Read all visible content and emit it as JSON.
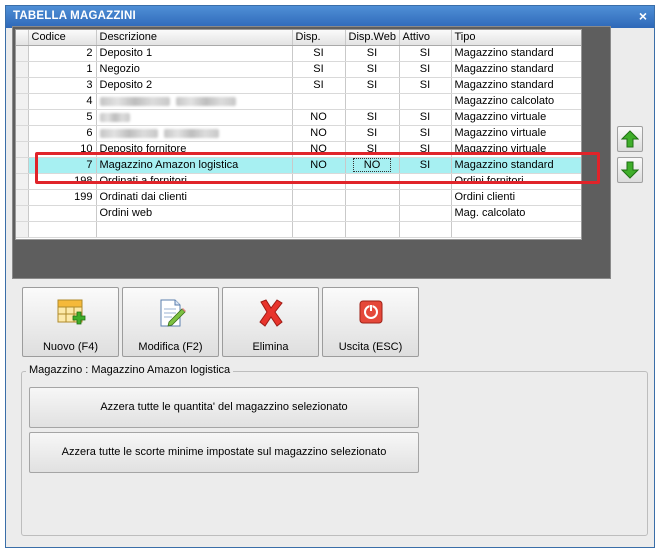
{
  "window": {
    "title": "TABELLA MAGAZZINI",
    "close_glyph": "×"
  },
  "table": {
    "columns": [
      "Codice",
      "Descrizione",
      "Disp.",
      "Disp.Web",
      "Attivo",
      "Tipo"
    ],
    "rows": [
      {
        "codice": "2",
        "descrizione": "Deposito 1",
        "disp": "SI",
        "disp_web": "SI",
        "attivo": "SI",
        "tipo": "Magazzino standard",
        "blurred": false
      },
      {
        "codice": "1",
        "descrizione": "Negozio",
        "disp": "SI",
        "disp_web": "SI",
        "attivo": "SI",
        "tipo": "Magazzino standard",
        "blurred": false
      },
      {
        "codice": "3",
        "descrizione": "Deposito 2",
        "disp": "SI",
        "disp_web": "SI",
        "attivo": "SI",
        "tipo": "Magazzino standard",
        "blurred": false
      },
      {
        "codice": "4",
        "descrizione": "",
        "disp": "",
        "disp_web": "",
        "attivo": "",
        "tipo": "Magazzino calcolato",
        "blurred": true
      },
      {
        "codice": "5",
        "descrizione": "",
        "disp": "NO",
        "disp_web": "SI",
        "attivo": "SI",
        "tipo": "Magazzino virtuale",
        "blurred": true
      },
      {
        "codice": "6",
        "descrizione": "",
        "disp": "NO",
        "disp_web": "SI",
        "attivo": "SI",
        "tipo": "Magazzino virtuale",
        "blurred": true
      },
      {
        "codice": "10",
        "descrizione": "Deposito fornitore",
        "disp": "NO",
        "disp_web": "SI",
        "attivo": "SI",
        "tipo": "Magazzino virtuale",
        "blurred": false
      },
      {
        "codice": "7",
        "descrizione": "Magazzino Amazon logistica",
        "disp": "NO",
        "disp_web": "NO",
        "attivo": "SI",
        "tipo": "Magazzino standard",
        "blurred": false,
        "selected": true
      },
      {
        "codice": "198",
        "descrizione": "Ordinati a fornitori",
        "disp": "",
        "disp_web": "",
        "attivo": "",
        "tipo": "Ordini fornitori",
        "blurred": false
      },
      {
        "codice": "199",
        "descrizione": "Ordinati dai clienti",
        "disp": "",
        "disp_web": "",
        "attivo": "",
        "tipo": "Ordini clienti",
        "blurred": false
      },
      {
        "codice": "",
        "descrizione": "Ordini web",
        "disp": "",
        "disp_web": "",
        "attivo": "",
        "tipo": "Mag. calcolato",
        "blurred": false
      }
    ]
  },
  "toolbar": {
    "new_label": "Nuovo (F4)",
    "edit_label": "Modifica (F2)",
    "delete_label": "Elimina",
    "exit_label": "Uscita (ESC)"
  },
  "group": {
    "legend": "Magazzino : Magazzino Amazon logistica",
    "reset_qty_label": "Azzera tutte le quantita' del magazzino selezionato",
    "reset_min_label": "Azzera tutte le scorte minime impostate sul magazzino selezionato"
  },
  "colors": {
    "title_bar": "#2e68b8",
    "selected_row": "#a7f0f2",
    "highlight_box": "#e0242a",
    "arrow_green": "#3fae2a"
  },
  "icons": {
    "up": "arrow-up-icon",
    "down": "arrow-down-icon",
    "new": "grid-add-icon",
    "edit": "document-edit-icon",
    "delete": "red-x-icon",
    "exit": "power-icon"
  }
}
